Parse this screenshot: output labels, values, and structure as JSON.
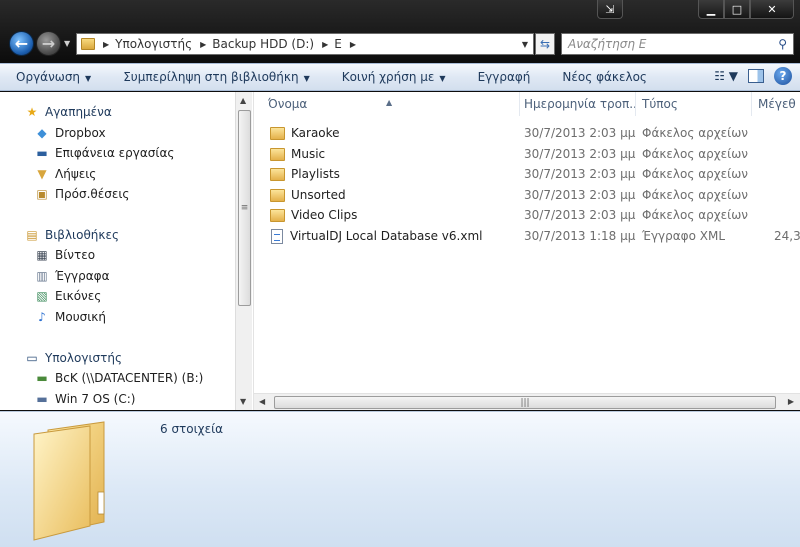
{
  "window": {
    "caption_extra": "⇲",
    "min": "▁",
    "max": "□",
    "close": "✕"
  },
  "address": {
    "crumbs": [
      "Υπολογιστής",
      "Backup HDD (D:)",
      "E"
    ]
  },
  "search": {
    "placeholder": "Αναζήτηση E"
  },
  "toolbar": {
    "organize": "Οργάνωση",
    "include_library": "Συμπερίληψη στη βιβλιοθήκη",
    "share_with": "Κοινή χρήση με",
    "burn": "Εγγραφή",
    "new_folder": "Νέος φάκελος"
  },
  "nav": {
    "favorites": "Αγαπημένα",
    "fav_items": [
      "Dropbox",
      "Επιφάνεια εργασίας",
      "Λήψεις",
      "Πρόσ.θέσεις"
    ],
    "libraries": "Βιβλιοθήκες",
    "lib_items": [
      "Βίντεο",
      "Έγγραφα",
      "Εικόνες",
      "Μουσική"
    ],
    "computer": "Υπολογιστής",
    "comp_items": [
      "BcK (\\\\DATACENTER) (B:)",
      "Win 7 OS (C:)"
    ]
  },
  "columns": {
    "name": "Όνομα",
    "date": "Ημερομηνία τροπ...",
    "type": "Τύπος",
    "size": "Μέγεθ"
  },
  "files": [
    {
      "name": "Karaoke",
      "date": "30/7/2013 2:03 μμ",
      "type": "Φάκελος αρχείων",
      "size": "",
      "icon": "folder-icon"
    },
    {
      "name": "Music",
      "date": "30/7/2013 2:03 μμ",
      "type": "Φάκελος αρχείων",
      "size": "",
      "icon": "folder-icon"
    },
    {
      "name": "Playlists",
      "date": "30/7/2013 2:03 μμ",
      "type": "Φάκελος αρχείων",
      "size": "",
      "icon": "folder-icon"
    },
    {
      "name": "Unsorted",
      "date": "30/7/2013 2:03 μμ",
      "type": "Φάκελος αρχείων",
      "size": "",
      "icon": "folder-icon"
    },
    {
      "name": "Video Clips",
      "date": "30/7/2013 2:03 μμ",
      "type": "Φάκελος αρχείων",
      "size": "",
      "icon": "folder-icon"
    },
    {
      "name": "VirtualDJ Local Database v6.xml",
      "date": "30/7/2013 1:18 μμ",
      "type": "Έγγραφο XML",
      "size": "24,3",
      "icon": "xml-file-icon"
    }
  ],
  "details": {
    "count": "6 στοιχεία"
  }
}
